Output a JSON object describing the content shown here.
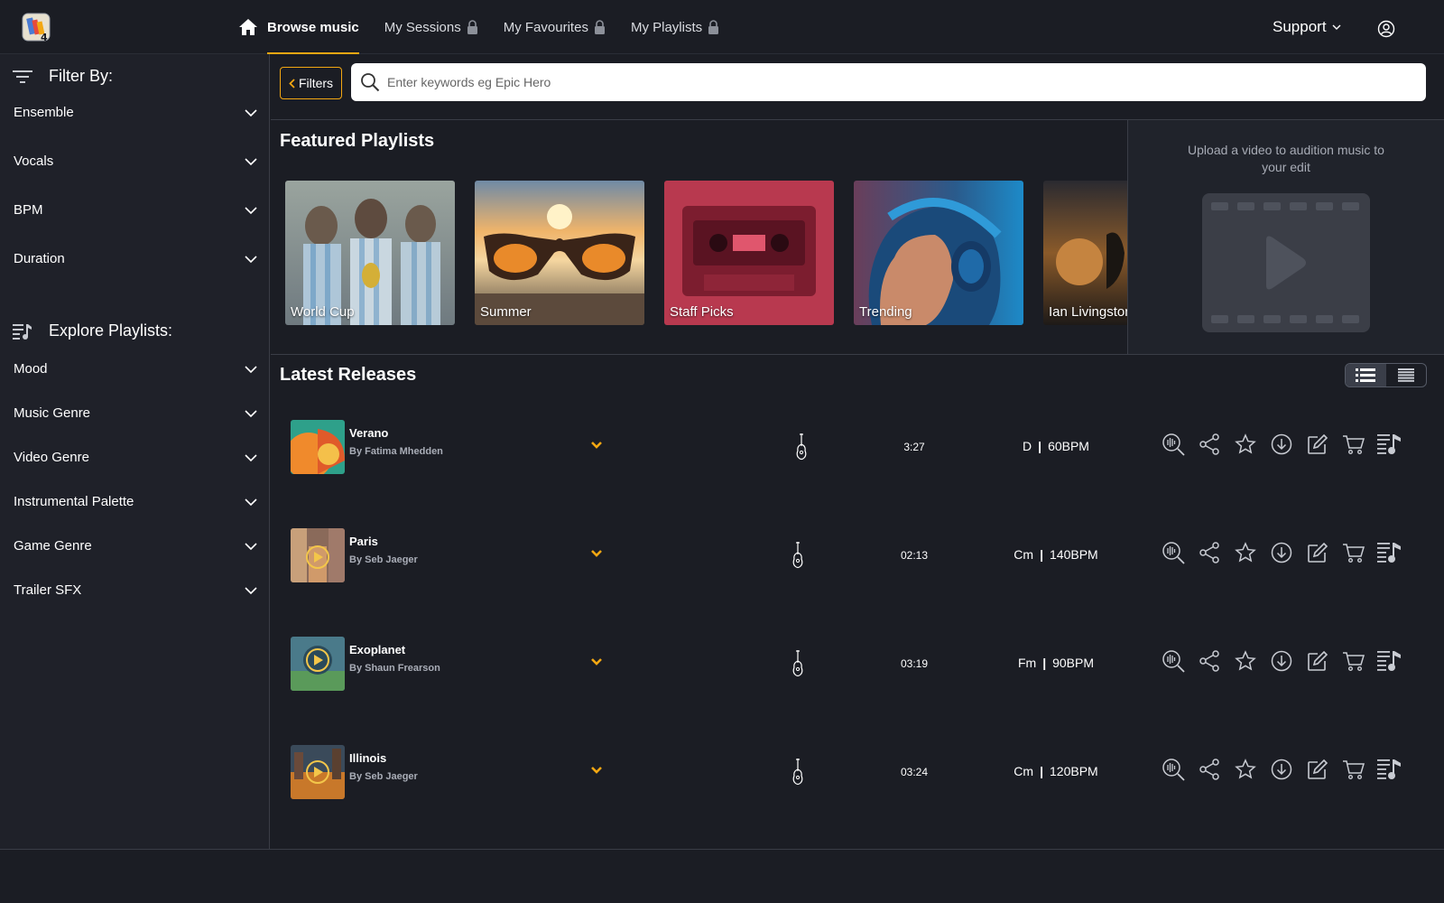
{
  "colors": {
    "accent": "#f3a712",
    "background": "#1b1d24",
    "sidebar": "#1f2129",
    "panel": "#20232b"
  },
  "nav": {
    "home_icon": "home-icon",
    "items": [
      {
        "label": "Browse music",
        "active": true,
        "locked": false
      },
      {
        "label": "My Sessions",
        "active": false,
        "locked": true
      },
      {
        "label": "My Favourites",
        "active": false,
        "locked": true
      },
      {
        "label": "My Playlists",
        "active": false,
        "locked": true
      }
    ],
    "support_label": "Support",
    "user_icon": "user-circle-icon"
  },
  "sidebar": {
    "filter_heading": "Filter By:",
    "filters": [
      "Ensemble",
      "Vocals",
      "BPM",
      "Duration"
    ],
    "explore_heading": "Explore Playlists:",
    "playlists": [
      "Mood",
      "Music Genre",
      "Video Genre",
      "Instrumental Palette",
      "Game Genre",
      "Trailer SFX"
    ]
  },
  "search": {
    "filters_label": "Filters",
    "placeholder": "Enter keywords eg Epic Hero"
  },
  "featured": {
    "title": "Featured Playlists",
    "cards": [
      "World Cup",
      "Summer",
      "Staff Picks",
      "Trending",
      "Ian Livingston"
    ]
  },
  "upload": {
    "text": "Upload a video to audition music to your edit"
  },
  "latest": {
    "title": "Latest Releases",
    "tracks": [
      {
        "title": "Verano",
        "artist": "By Fatima Mhedden",
        "duration": "3:27",
        "key": "D",
        "bpm": "60BPM"
      },
      {
        "title": "Paris",
        "artist": "By Seb Jaeger",
        "duration": "02:13",
        "key": "Cm",
        "bpm": "140BPM"
      },
      {
        "title": "Exoplanet",
        "artist": "By Shaun Frearson",
        "duration": "03:19",
        "key": "Fm",
        "bpm": "90BPM"
      },
      {
        "title": "Illinois",
        "artist": "By Seb Jaeger",
        "duration": "03:24",
        "key": "Cm",
        "bpm": "120BPM"
      }
    ],
    "action_icons": [
      "similar-search-icon",
      "share-icon",
      "star-icon",
      "download-icon",
      "edit-icon",
      "cart-icon",
      "add-to-playlist-icon"
    ]
  }
}
